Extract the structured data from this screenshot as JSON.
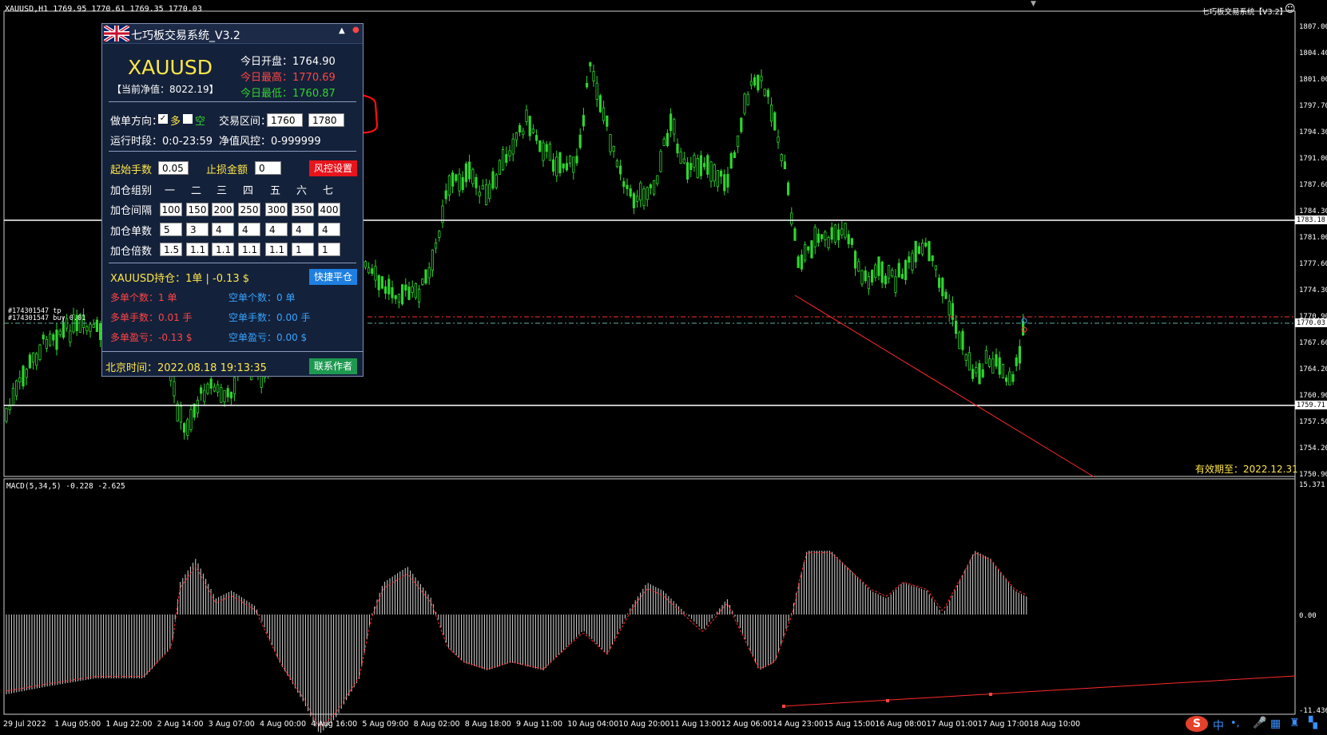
{
  "chart_header": "XAUUSD,H1  1769.95 1770.61 1769.35 1770.03",
  "top_right_label": "七巧板交易系统【V3.2】",
  "macd_label": "MACD(5,34,5) -0.228 -2.625",
  "validity": "有效期至：2022.12.31",
  "order_labels": [
    "#174301547 tp",
    "#174301547 buy 0.01"
  ],
  "price_axis": [
    "1807.00",
    "1804.40",
    "1801.00",
    "1797.70",
    "1794.30",
    "1791.00",
    "1787.60",
    "1784.30",
    "1781.00",
    "1777.60",
    "1774.30",
    "1770.90",
    "1767.60",
    "1764.20",
    "1760.90",
    "1757.50",
    "1754.20",
    "1750.90"
  ],
  "price_highlights": {
    "white_line": "1783.18",
    "current": "1770.03",
    "low_line": "1759.71"
  },
  "macd_axis": {
    "top": "15.371",
    "zero": "0.00",
    "bottom": "-11.436"
  },
  "time_axis": [
    "29 Jul 2022",
    "1 Aug 05:00",
    "1 Aug 22:00",
    "2 Aug 14:00",
    "3 Aug 07:00",
    "4 Aug 00:00",
    "4 Aug 16:00",
    "5 Aug 09:00",
    "8 Aug 02:00",
    "8 Aug 18:00",
    "9 Aug 11:00",
    "10 Aug 04:00",
    "10 Aug 20:00",
    "11 Aug 13:00",
    "12 Aug 06:00",
    "14 Aug 23:00",
    "15 Aug 15:00",
    "16 Aug 08:00",
    "17 Aug 01:00",
    "17 Aug 17:00",
    "18 Aug 10:00"
  ],
  "panel": {
    "title": "七巧板交易系统_V3.2",
    "symbol": "XAUUSD",
    "equity": "【当前净值：8022.19】",
    "open_label": "今日开盘：1764.90",
    "high_label": "今日最高：1770.69",
    "low_label": "今日最低：1760.87",
    "direction_label": "做单方向：",
    "long_label": "多",
    "short_label": "空",
    "range_label": "交易区间：",
    "range_low": "1760",
    "range_high": "1780",
    "run_time": "运行时段：0:0-23:59",
    "risk": "净值风控：0-999999",
    "start_lots_label": "起始手数",
    "start_lots": "0.05",
    "stop_amount_label": "止损金额",
    "stop_amount": "0",
    "risk_button": "风控设置",
    "group_label": "加仓组别",
    "groups": [
      "一",
      "二",
      "三",
      "四",
      "五",
      "六",
      "七"
    ],
    "interval_label": "加仓间隔",
    "intervals": [
      "100",
      "150",
      "200",
      "250",
      "300",
      "350",
      "400"
    ],
    "count_label": "加仓单数",
    "counts": [
      "5",
      "3",
      "4",
      "4",
      "4",
      "4",
      "4"
    ],
    "mult_label": "加仓倍数",
    "mults": [
      "1.5",
      "1.1",
      "1.1",
      "1.1",
      "1.1",
      "1",
      "1"
    ],
    "position": "XAUUSD持仓：1单 | -0.13 $",
    "close_button": "快捷平仓",
    "long_count": "多单个数：1 单",
    "short_count": "空单个数：0 单",
    "long_lots": "多单手数：0.01 手",
    "short_lots": "空单手数：0.00 手",
    "long_pnl": "多单盈亏：-0.13 $",
    "short_pnl": "空单盈亏：0.00 $",
    "beijing_time": "北京时间：2022.08.18 19:13:35",
    "contact_button": "联系作者"
  },
  "colors": {
    "bull": "#2ed52e",
    "bear": "#2ed52e",
    "accent_red": "#ff2a2a",
    "panel_bg": "#14213a"
  },
  "taskbar": {
    "ime": "中"
  }
}
